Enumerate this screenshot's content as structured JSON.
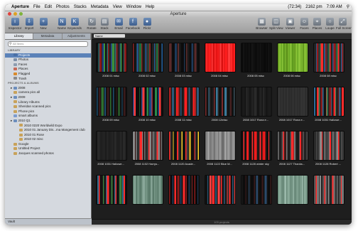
{
  "menubar": {
    "apple": "",
    "items": [
      "Aperture",
      "File",
      "Edit",
      "Photos",
      "Stacks",
      "Metadata",
      "View",
      "Window",
      "Help"
    ],
    "battery": "(72:34)",
    "wifi": "2162 pm",
    "time": "7:09 AM"
  },
  "window": {
    "title": "Aperture"
  },
  "toolbar": {
    "left": [
      {
        "label": "Inspector",
        "icon": "i"
      },
      {
        "label": "Import",
        "icon": "⇩"
      },
      {
        "label": "New",
        "icon": "+"
      },
      {
        "label": "Name",
        "icon": "N"
      },
      {
        "label": "Keywords",
        "icon": "K"
      },
      {
        "label": "Rotate",
        "icon": "↻"
      },
      {
        "label": "Stack",
        "icon": "▤"
      },
      {
        "label": "Email",
        "icon": "✉"
      },
      {
        "label": "Facebook",
        "icon": "f"
      },
      {
        "label": "Flickr",
        "icon": "●"
      }
    ],
    "right": [
      {
        "label": "Browser",
        "icon": "▦"
      },
      {
        "label": "Split View",
        "icon": "◫"
      },
      {
        "label": "Viewer",
        "icon": "▣"
      },
      {
        "label": "Faces",
        "icon": "☺"
      },
      {
        "label": "Places",
        "icon": "⌖"
      },
      {
        "label": "Loupe",
        "icon": "○"
      },
      {
        "label": "Full Screen",
        "icon": "⤢"
      }
    ]
  },
  "sidebar": {
    "tabs": [
      "Library",
      "Metadata",
      "Adjustments"
    ],
    "search_placeholder": "All Items",
    "rows": [
      {
        "label": "LIBRARY",
        "type": "head"
      },
      {
        "label": "Projects",
        "type": "item",
        "selected": true,
        "color": "#4a6fa5"
      },
      {
        "label": "Photos",
        "type": "item",
        "color": "#7d8fa8"
      },
      {
        "label": "Faces",
        "type": "item",
        "color": "#8d9cb0"
      },
      {
        "label": "Places",
        "type": "item",
        "color": "#c56a5a"
      },
      {
        "label": "Flagged",
        "type": "item",
        "color": "#d98a2b"
      },
      {
        "label": "Trash",
        "type": "item",
        "color": "#8a8a8a"
      },
      {
        "label": "PROJECTS & ALBUMS",
        "type": "head"
      },
      {
        "label": "2008",
        "type": "folder",
        "color": "#6b8dbd"
      },
      {
        "label": "camera pics all",
        "type": "item",
        "color": "#c8a25a"
      },
      {
        "label": "2009",
        "type": "folder",
        "color": "#6b8dbd"
      },
      {
        "label": "Library Albums",
        "type": "item",
        "color": "#c8a25a"
      },
      {
        "label": "Sheridan scanned pics",
        "type": "item",
        "color": "#c8a25a"
      },
      {
        "label": "Phone pics",
        "type": "item",
        "color": "#c8a25a"
      },
      {
        "label": "smart albums",
        "type": "item",
        "color": "#7c9ccf"
      },
      {
        "label": "2010 Q1",
        "type": "folder",
        "color": "#6b8dbd"
      },
      {
        "label": "2010 0220 Worldwild Expo",
        "type": "sub",
        "color": "#c8a25a"
      },
      {
        "label": "2010 01 January Dis...ma Mangement club",
        "type": "sub",
        "color": "#c8a25a"
      },
      {
        "label": "2010 01 Rose",
        "type": "sub",
        "color": "#c8a25a"
      },
      {
        "label": "2010 02 misc",
        "type": "sub",
        "color": "#c8a25a"
      },
      {
        "label": "Google",
        "type": "item",
        "color": "#c8a25a"
      },
      {
        "label": "Untitled Project",
        "type": "item",
        "color": "#c8a25a"
      },
      {
        "label": "Jacques scanned photos",
        "type": "item",
        "color": "#c8a25a"
      }
    ],
    "vault": "Vault"
  },
  "browser": {
    "sort_value": "Name",
    "status": "103 projects",
    "projects": [
      {
        "name": "2008 01 misc",
        "palette": [
          "#111",
          "#3b8f3a",
          "#1f3f8f",
          "#222",
          "#8a1a1a",
          "#2b6f6f"
        ]
      },
      {
        "name": "2008 02 misc",
        "palette": [
          "#111",
          "#8a2222",
          "#1a6f3a",
          "#333",
          "#1f5f9f",
          "#222"
        ]
      },
      {
        "name": "2008 03 misc",
        "palette": [
          "#0c0c0c",
          "#1a1a1a",
          "#5a2a2a",
          "#111",
          "#1e3a5a",
          "#0c0c0c"
        ]
      },
      {
        "name": "2008 04 misc",
        "palette": [
          "#ff1e1e",
          "#e51414",
          "#ff2a2a",
          "#d81010",
          "#ff3a3a",
          "#e41a1a"
        ]
      },
      {
        "name": "2008 05 misc",
        "palette": [
          "#0a0a0a",
          "#101010",
          "#0d0d0d",
          "#141414",
          "#0a0a0a",
          "#111"
        ]
      },
      {
        "name": "2008 06 misc",
        "palette": [
          "#79b32d",
          "#5f9a1e",
          "#8cc63a",
          "#6aa824",
          "#86bf34",
          "#5e941c"
        ]
      },
      {
        "name": "2008 08 misc",
        "palette": [
          "#222",
          "#ff2a2a",
          "#1a7a4a",
          "#333",
          "#9a1a1a",
          "#2a5a8a"
        ]
      },
      {
        "name": "2008 09 misc",
        "palette": [
          "#0f0f0f",
          "#1d4f6f",
          "#111",
          "#2f6f2f",
          "#0f0f0f",
          "#3a1a1a"
        ]
      },
      {
        "name": "2008 10 misc",
        "palette": [
          "#0d0d0d",
          "#ff3a3a",
          "#1a4a8a",
          "#111",
          "#2a8a4a",
          "#0d0d0d"
        ]
      },
      {
        "name": "2008 11 misc",
        "palette": [
          "#1a1a1a",
          "#2a5a7a",
          "#1a1a1a",
          "#aa2222",
          "#ff2020",
          "#222"
        ]
      },
      {
        "name": "2008 12misc",
        "palette": [
          "#111",
          "#2a2a2a",
          "#3a7a9a",
          "#111",
          "#7a2a2a",
          "#1a1a1a"
        ]
      },
      {
        "name": "2008 1017 Rona e...",
        "palette": [
          "#141414",
          "#1f1f1f",
          "#2a2a2a",
          "#151515",
          "#232323",
          "#181818"
        ]
      },
      {
        "name": "2008 1017 Rona e...",
        "palette": [
          "#2b2b2b",
          "#333",
          "#2a2a2a",
          "#303030",
          "#2c2c2c",
          "#353535"
        ]
      },
      {
        "name": "2008 1031 Hallowe...",
        "palette": [
          "#111",
          "#2a6f9a",
          "#8a1a1a",
          "#222",
          "#3a8a5a",
          "#ff2a2a"
        ]
      },
      {
        "name": "2008 1031 Hallowe...",
        "palette": [
          "#202020",
          "#2a2a2a",
          "#1c1c1c",
          "#262626",
          "#222",
          "#1e1e1e"
        ]
      },
      {
        "name": "2008 1102 Harrys...",
        "palette": [
          "#2a2a2a",
          "#6a6a6a",
          "#3a1a1a",
          "#888",
          "#ff2a2a",
          "#444"
        ]
      },
      {
        "name": "2008 1120 Acade...",
        "palette": [
          "#0f0f0f",
          "#ffd02a",
          "#1a1a1a",
          "#3a3a3a",
          "#ff2a2a",
          "#111"
        ]
      },
      {
        "name": "2008 1122 Blue M...",
        "palette": [
          "#888",
          "#9a9a9a",
          "#7a7a7a",
          "#a8a8a8",
          "#8c8c8c",
          "#6c6c6c"
        ]
      },
      {
        "name": "2008 1128 winter sky",
        "palette": [
          "#0f0f0f",
          "#1a1a1a",
          "#ff2020",
          "#e61a1a",
          "#151515",
          "#ff3030"
        ]
      },
      {
        "name": "2008 1127 Thanks...",
        "palette": [
          "#222",
          "#777",
          "#3a1a1a",
          "#ff2a2a",
          "#555",
          "#1a1a1a"
        ]
      },
      {
        "name": "2008 1128 Robert ...",
        "palette": [
          "#333",
          "#666",
          "#2a2a2a",
          "#ff2a2a",
          "#888",
          "#444"
        ]
      },
      {
        "name": "",
        "palette": [
          "#111",
          "#ff2a2a",
          "#2a6a8a",
          "#111",
          "#3a7a3a",
          "#1a1a1a"
        ]
      },
      {
        "name": "",
        "palette": [
          "#6a8a7a",
          "#7a9a8a",
          "#5a7a6a",
          "#8aa89a",
          "#6a8a7a",
          "#5a7a6a"
        ]
      },
      {
        "name": "",
        "palette": [
          "#0a0a0a",
          "#ff2a2a",
          "#151515",
          "#1a3a5a",
          "#0a0a0a",
          "#8a1a1a"
        ]
      },
      {
        "name": "",
        "palette": [
          "#121212",
          "#ff2a2a",
          "#2a2a2a",
          "#ff4040",
          "#1a1a1a",
          "#2a5a7a"
        ]
      },
      {
        "name": "",
        "palette": [
          "#0d0d0d",
          "#1a1a1a",
          "#2a4a6a",
          "#111",
          "#3a1a1a",
          "#0d0d0d"
        ]
      },
      {
        "name": "",
        "palette": [
          "#7a9a8a",
          "#8aaa9a",
          "#6a8a7a",
          "#9ab8aa",
          "#7a9a8a",
          "#6a8a7a"
        ]
      },
      {
        "name": "",
        "palette": [
          "#333",
          "#777",
          "#ff2a2a",
          "#555",
          "#222",
          "#888"
        ]
      }
    ]
  }
}
